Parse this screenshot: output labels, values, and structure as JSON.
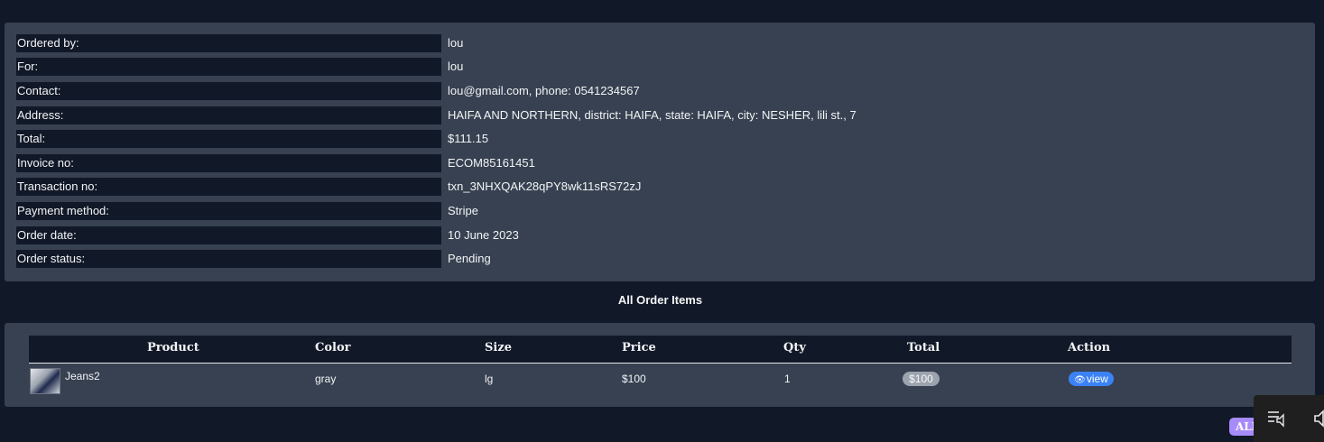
{
  "order_info": [
    {
      "label": "Ordered by:",
      "value": "lou"
    },
    {
      "label": "For:",
      "value": "lou"
    },
    {
      "label": "Contact:",
      "value": "lou@gmail.com, phone: 0541234567"
    },
    {
      "label": "Address:",
      "value": "HAIFA AND NORTHERN, district: HAIFA, state: HAIFA, city: NESHER, lili st., 7"
    },
    {
      "label": "Total:",
      "value": "$111.15"
    },
    {
      "label": "Invoice no:",
      "value": "ECOM85161451"
    },
    {
      "label": "Transaction no:",
      "value": "txn_3NHXQAK28qPY8wk11sRS72zJ"
    },
    {
      "label": "Payment method:",
      "value": "Stripe"
    },
    {
      "label": "Order date:",
      "value": "10 June 2023"
    },
    {
      "label": "Order status:",
      "value": "Pending"
    }
  ],
  "items_section": {
    "title": "All Order Items",
    "columns": [
      "Product",
      "Color",
      "Size",
      "Price",
      "Qty",
      "Total",
      "Action"
    ],
    "rows": [
      {
        "product": "Jeans2",
        "color": "gray",
        "size": "lg",
        "price": "$100",
        "qty": "1",
        "total": "$100",
        "action_label": "view",
        "action_icon": "eye-icon"
      }
    ]
  },
  "floating_badge": {
    "label": "ALL"
  },
  "media_overlay": {
    "icons": [
      "queue-icon",
      "speaker-icon"
    ]
  },
  "colors": {
    "page_bg": "#111827",
    "card_bg": "#374151",
    "badge_gray": "#9ca3af",
    "view_blue": "#3b82f6",
    "all_purple": "#a78bfa"
  }
}
